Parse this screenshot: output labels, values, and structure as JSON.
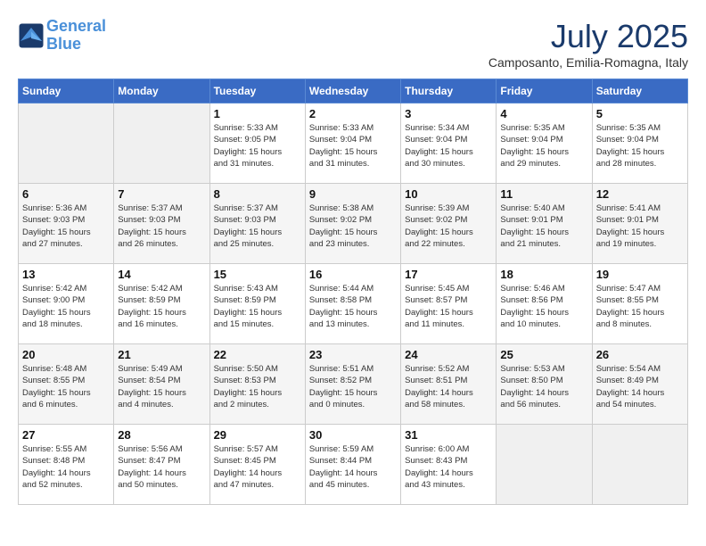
{
  "header": {
    "logo_line1": "General",
    "logo_line2": "Blue",
    "month": "July 2025",
    "location": "Camposanto, Emilia-Romagna, Italy"
  },
  "days_of_week": [
    "Sunday",
    "Monday",
    "Tuesday",
    "Wednesday",
    "Thursday",
    "Friday",
    "Saturday"
  ],
  "weeks": [
    [
      {
        "day": "",
        "info": ""
      },
      {
        "day": "",
        "info": ""
      },
      {
        "day": "1",
        "info": "Sunrise: 5:33 AM\nSunset: 9:05 PM\nDaylight: 15 hours\nand 31 minutes."
      },
      {
        "day": "2",
        "info": "Sunrise: 5:33 AM\nSunset: 9:04 PM\nDaylight: 15 hours\nand 31 minutes."
      },
      {
        "day": "3",
        "info": "Sunrise: 5:34 AM\nSunset: 9:04 PM\nDaylight: 15 hours\nand 30 minutes."
      },
      {
        "day": "4",
        "info": "Sunrise: 5:35 AM\nSunset: 9:04 PM\nDaylight: 15 hours\nand 29 minutes."
      },
      {
        "day": "5",
        "info": "Sunrise: 5:35 AM\nSunset: 9:04 PM\nDaylight: 15 hours\nand 28 minutes."
      }
    ],
    [
      {
        "day": "6",
        "info": "Sunrise: 5:36 AM\nSunset: 9:03 PM\nDaylight: 15 hours\nand 27 minutes."
      },
      {
        "day": "7",
        "info": "Sunrise: 5:37 AM\nSunset: 9:03 PM\nDaylight: 15 hours\nand 26 minutes."
      },
      {
        "day": "8",
        "info": "Sunrise: 5:37 AM\nSunset: 9:03 PM\nDaylight: 15 hours\nand 25 minutes."
      },
      {
        "day": "9",
        "info": "Sunrise: 5:38 AM\nSunset: 9:02 PM\nDaylight: 15 hours\nand 23 minutes."
      },
      {
        "day": "10",
        "info": "Sunrise: 5:39 AM\nSunset: 9:02 PM\nDaylight: 15 hours\nand 22 minutes."
      },
      {
        "day": "11",
        "info": "Sunrise: 5:40 AM\nSunset: 9:01 PM\nDaylight: 15 hours\nand 21 minutes."
      },
      {
        "day": "12",
        "info": "Sunrise: 5:41 AM\nSunset: 9:01 PM\nDaylight: 15 hours\nand 19 minutes."
      }
    ],
    [
      {
        "day": "13",
        "info": "Sunrise: 5:42 AM\nSunset: 9:00 PM\nDaylight: 15 hours\nand 18 minutes."
      },
      {
        "day": "14",
        "info": "Sunrise: 5:42 AM\nSunset: 8:59 PM\nDaylight: 15 hours\nand 16 minutes."
      },
      {
        "day": "15",
        "info": "Sunrise: 5:43 AM\nSunset: 8:59 PM\nDaylight: 15 hours\nand 15 minutes."
      },
      {
        "day": "16",
        "info": "Sunrise: 5:44 AM\nSunset: 8:58 PM\nDaylight: 15 hours\nand 13 minutes."
      },
      {
        "day": "17",
        "info": "Sunrise: 5:45 AM\nSunset: 8:57 PM\nDaylight: 15 hours\nand 11 minutes."
      },
      {
        "day": "18",
        "info": "Sunrise: 5:46 AM\nSunset: 8:56 PM\nDaylight: 15 hours\nand 10 minutes."
      },
      {
        "day": "19",
        "info": "Sunrise: 5:47 AM\nSunset: 8:55 PM\nDaylight: 15 hours\nand 8 minutes."
      }
    ],
    [
      {
        "day": "20",
        "info": "Sunrise: 5:48 AM\nSunset: 8:55 PM\nDaylight: 15 hours\nand 6 minutes."
      },
      {
        "day": "21",
        "info": "Sunrise: 5:49 AM\nSunset: 8:54 PM\nDaylight: 15 hours\nand 4 minutes."
      },
      {
        "day": "22",
        "info": "Sunrise: 5:50 AM\nSunset: 8:53 PM\nDaylight: 15 hours\nand 2 minutes."
      },
      {
        "day": "23",
        "info": "Sunrise: 5:51 AM\nSunset: 8:52 PM\nDaylight: 15 hours\nand 0 minutes."
      },
      {
        "day": "24",
        "info": "Sunrise: 5:52 AM\nSunset: 8:51 PM\nDaylight: 14 hours\nand 58 minutes."
      },
      {
        "day": "25",
        "info": "Sunrise: 5:53 AM\nSunset: 8:50 PM\nDaylight: 14 hours\nand 56 minutes."
      },
      {
        "day": "26",
        "info": "Sunrise: 5:54 AM\nSunset: 8:49 PM\nDaylight: 14 hours\nand 54 minutes."
      }
    ],
    [
      {
        "day": "27",
        "info": "Sunrise: 5:55 AM\nSunset: 8:48 PM\nDaylight: 14 hours\nand 52 minutes."
      },
      {
        "day": "28",
        "info": "Sunrise: 5:56 AM\nSunset: 8:47 PM\nDaylight: 14 hours\nand 50 minutes."
      },
      {
        "day": "29",
        "info": "Sunrise: 5:57 AM\nSunset: 8:45 PM\nDaylight: 14 hours\nand 47 minutes."
      },
      {
        "day": "30",
        "info": "Sunrise: 5:59 AM\nSunset: 8:44 PM\nDaylight: 14 hours\nand 45 minutes."
      },
      {
        "day": "31",
        "info": "Sunrise: 6:00 AM\nSunset: 8:43 PM\nDaylight: 14 hours\nand 43 minutes."
      },
      {
        "day": "",
        "info": ""
      },
      {
        "day": "",
        "info": ""
      }
    ]
  ]
}
